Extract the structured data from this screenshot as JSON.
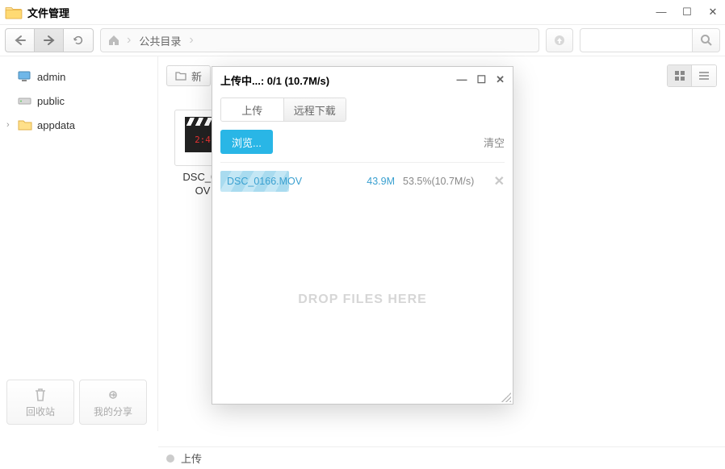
{
  "window": {
    "title": "文件管理"
  },
  "breadcrumb": {
    "segments": [
      "公共目录"
    ]
  },
  "sidebar": {
    "items": [
      {
        "label": "admin"
      },
      {
        "label": "public"
      },
      {
        "label": "appdata"
      }
    ],
    "footer": {
      "recycle": "回收站",
      "share": "我的分享"
    }
  },
  "main_toolbar": {
    "new_folder": "新"
  },
  "file": {
    "name_line1": "DSC_01",
    "name_line2": "OV",
    "clap_text": "2:4"
  },
  "dialog": {
    "title": "上传中...: 0/1 (10.7M/s)",
    "tabs": {
      "upload": "上传",
      "remote": "远程下载"
    },
    "browse": "浏览...",
    "clear": "清空",
    "dropzone": "DROP FILES HERE",
    "item": {
      "name": "DSC_0166.MOV",
      "size": "43.9M",
      "progress_pct": 53.5,
      "rate": "53.5%(10.7M/s)"
    }
  },
  "statusbar": {
    "label": "上传"
  }
}
